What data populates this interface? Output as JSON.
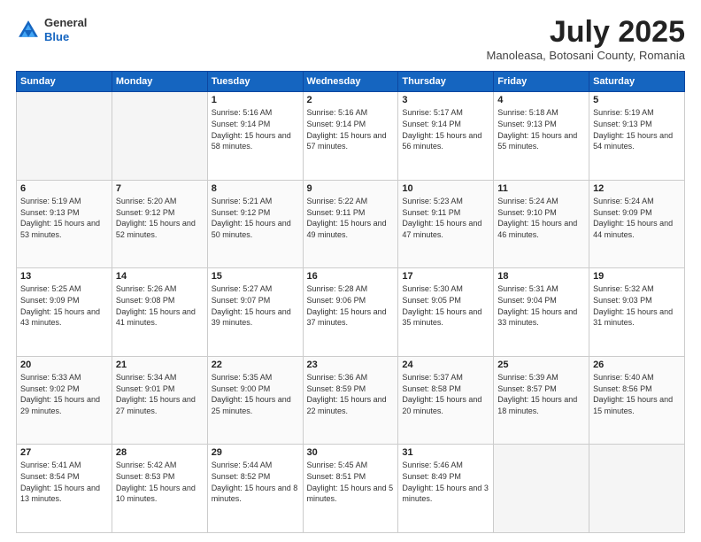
{
  "header": {
    "logo_general": "General",
    "logo_blue": "Blue",
    "month_year": "July 2025",
    "location": "Manoleasa, Botosani County, Romania"
  },
  "days_of_week": [
    "Sunday",
    "Monday",
    "Tuesday",
    "Wednesday",
    "Thursday",
    "Friday",
    "Saturday"
  ],
  "weeks": [
    [
      {
        "day": "",
        "empty": true
      },
      {
        "day": "",
        "empty": true
      },
      {
        "day": "1",
        "sunrise": "5:16 AM",
        "sunset": "9:14 PM",
        "daylight": "15 hours and 58 minutes."
      },
      {
        "day": "2",
        "sunrise": "5:16 AM",
        "sunset": "9:14 PM",
        "daylight": "15 hours and 57 minutes."
      },
      {
        "day": "3",
        "sunrise": "5:17 AM",
        "sunset": "9:14 PM",
        "daylight": "15 hours and 56 minutes."
      },
      {
        "day": "4",
        "sunrise": "5:18 AM",
        "sunset": "9:13 PM",
        "daylight": "15 hours and 55 minutes."
      },
      {
        "day": "5",
        "sunrise": "5:19 AM",
        "sunset": "9:13 PM",
        "daylight": "15 hours and 54 minutes."
      }
    ],
    [
      {
        "day": "6",
        "sunrise": "5:19 AM",
        "sunset": "9:13 PM",
        "daylight": "15 hours and 53 minutes."
      },
      {
        "day": "7",
        "sunrise": "5:20 AM",
        "sunset": "9:12 PM",
        "daylight": "15 hours and 52 minutes."
      },
      {
        "day": "8",
        "sunrise": "5:21 AM",
        "sunset": "9:12 PM",
        "daylight": "15 hours and 50 minutes."
      },
      {
        "day": "9",
        "sunrise": "5:22 AM",
        "sunset": "9:11 PM",
        "daylight": "15 hours and 49 minutes."
      },
      {
        "day": "10",
        "sunrise": "5:23 AM",
        "sunset": "9:11 PM",
        "daylight": "15 hours and 47 minutes."
      },
      {
        "day": "11",
        "sunrise": "5:24 AM",
        "sunset": "9:10 PM",
        "daylight": "15 hours and 46 minutes."
      },
      {
        "day": "12",
        "sunrise": "5:24 AM",
        "sunset": "9:09 PM",
        "daylight": "15 hours and 44 minutes."
      }
    ],
    [
      {
        "day": "13",
        "sunrise": "5:25 AM",
        "sunset": "9:09 PM",
        "daylight": "15 hours and 43 minutes."
      },
      {
        "day": "14",
        "sunrise": "5:26 AM",
        "sunset": "9:08 PM",
        "daylight": "15 hours and 41 minutes."
      },
      {
        "day": "15",
        "sunrise": "5:27 AM",
        "sunset": "9:07 PM",
        "daylight": "15 hours and 39 minutes."
      },
      {
        "day": "16",
        "sunrise": "5:28 AM",
        "sunset": "9:06 PM",
        "daylight": "15 hours and 37 minutes."
      },
      {
        "day": "17",
        "sunrise": "5:30 AM",
        "sunset": "9:05 PM",
        "daylight": "15 hours and 35 minutes."
      },
      {
        "day": "18",
        "sunrise": "5:31 AM",
        "sunset": "9:04 PM",
        "daylight": "15 hours and 33 minutes."
      },
      {
        "day": "19",
        "sunrise": "5:32 AM",
        "sunset": "9:03 PM",
        "daylight": "15 hours and 31 minutes."
      }
    ],
    [
      {
        "day": "20",
        "sunrise": "5:33 AM",
        "sunset": "9:02 PM",
        "daylight": "15 hours and 29 minutes."
      },
      {
        "day": "21",
        "sunrise": "5:34 AM",
        "sunset": "9:01 PM",
        "daylight": "15 hours and 27 minutes."
      },
      {
        "day": "22",
        "sunrise": "5:35 AM",
        "sunset": "9:00 PM",
        "daylight": "15 hours and 25 minutes."
      },
      {
        "day": "23",
        "sunrise": "5:36 AM",
        "sunset": "8:59 PM",
        "daylight": "15 hours and 22 minutes."
      },
      {
        "day": "24",
        "sunrise": "5:37 AM",
        "sunset": "8:58 PM",
        "daylight": "15 hours and 20 minutes."
      },
      {
        "day": "25",
        "sunrise": "5:39 AM",
        "sunset": "8:57 PM",
        "daylight": "15 hours and 18 minutes."
      },
      {
        "day": "26",
        "sunrise": "5:40 AM",
        "sunset": "8:56 PM",
        "daylight": "15 hours and 15 minutes."
      }
    ],
    [
      {
        "day": "27",
        "sunrise": "5:41 AM",
        "sunset": "8:54 PM",
        "daylight": "15 hours and 13 minutes."
      },
      {
        "day": "28",
        "sunrise": "5:42 AM",
        "sunset": "8:53 PM",
        "daylight": "15 hours and 10 minutes."
      },
      {
        "day": "29",
        "sunrise": "5:44 AM",
        "sunset": "8:52 PM",
        "daylight": "15 hours and 8 minutes."
      },
      {
        "day": "30",
        "sunrise": "5:45 AM",
        "sunset": "8:51 PM",
        "daylight": "15 hours and 5 minutes."
      },
      {
        "day": "31",
        "sunrise": "5:46 AM",
        "sunset": "8:49 PM",
        "daylight": "15 hours and 3 minutes."
      },
      {
        "day": "",
        "empty": true
      },
      {
        "day": "",
        "empty": true
      }
    ]
  ]
}
